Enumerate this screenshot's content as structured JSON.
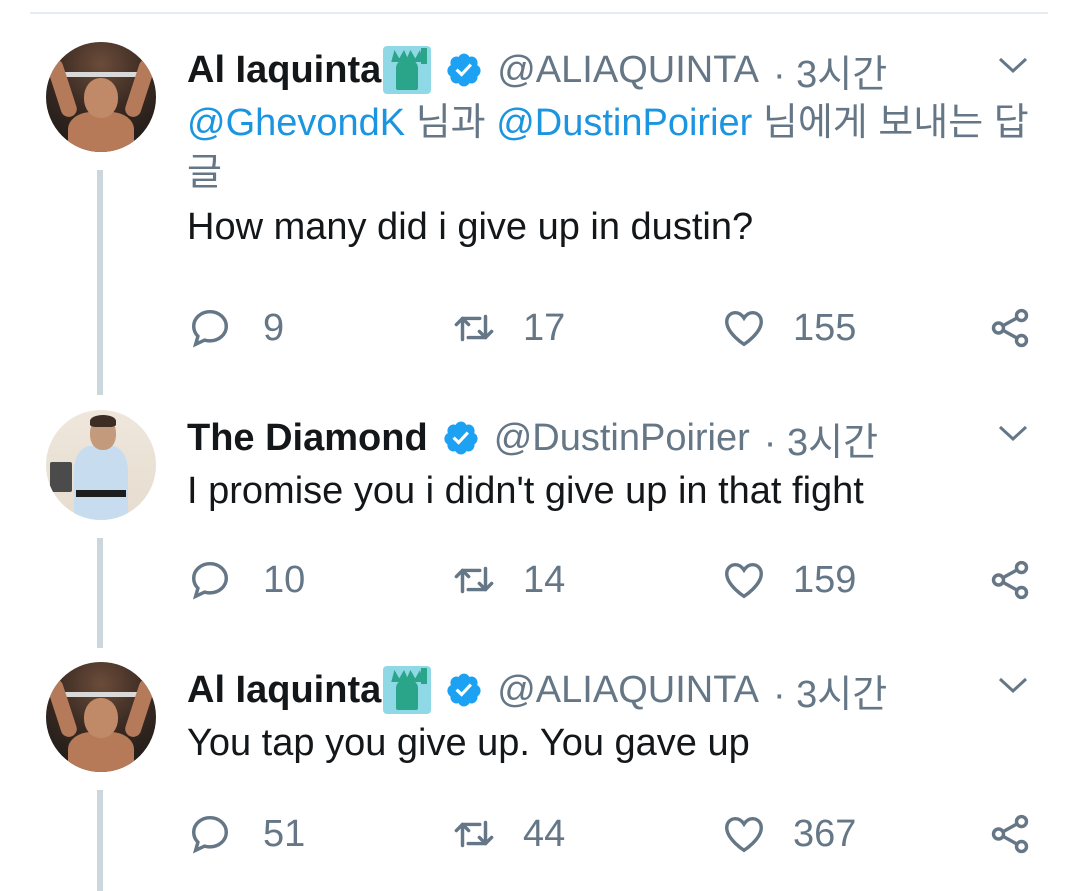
{
  "colors": {
    "link": "#1b95e0",
    "secondary": "#657786",
    "thread_line": "#ccd6dd",
    "verified": "#1da1f2"
  },
  "tweets": [
    {
      "name": "Al Iaquinta",
      "name_emoji": "statue-of-liberty-icon",
      "handle": "@ALIAQUINTA",
      "time": "· 3시간",
      "reply_to": {
        "mention1": "@GhevondK",
        "mid": " 님과 ",
        "mention2": "@DustinPoirier",
        "tail": " 님에게 보내는 답글"
      },
      "text": "How many did i give up in dustin?",
      "replies": "9",
      "retweets": "17",
      "likes": "155"
    },
    {
      "name": "The Diamond",
      "handle": "@DustinPoirier",
      "time": "· 3시간",
      "text": "I promise you i didn't give up in that fight",
      "replies": "10",
      "retweets": "14",
      "likes": "159"
    },
    {
      "name": "Al Iaquinta",
      "name_emoji": "statue-of-liberty-icon",
      "handle": "@ALIAQUINTA",
      "time": "· 3시간",
      "text": "You tap you give up. You gave up",
      "replies": "51",
      "retweets": "44",
      "likes": "367"
    }
  ]
}
